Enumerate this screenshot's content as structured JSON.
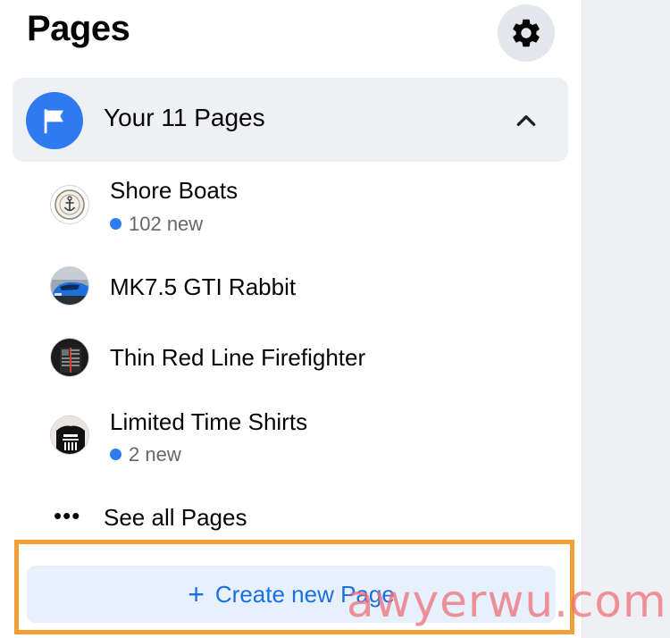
{
  "header": {
    "title": "Pages",
    "settings_icon": "gear-icon"
  },
  "pages_group": {
    "icon": "flag-icon",
    "title": "Your 11 Pages",
    "toggle_icon": "chevron-up-icon",
    "items": [
      {
        "name": "Shore Boats",
        "badge": "102 new",
        "avatar": "anchor-logo"
      },
      {
        "name": "MK7.5 GTI Rabbit",
        "badge": "",
        "avatar": "blue-car-photo"
      },
      {
        "name": "Thin Red Line Firefighter",
        "badge": "",
        "avatar": "flag-shirt-photo"
      },
      {
        "name": "Limited Time Shirts",
        "badge": "2 new",
        "avatar": "black-shirt-photo"
      }
    ],
    "see_all_label": "See all Pages",
    "see_all_icon": "more-dots-icon"
  },
  "create_button": {
    "label": "Create new Page",
    "icon": "plus-icon"
  },
  "watermark": "awyerwu.com",
  "colors": {
    "accent": "#2e7bf0",
    "highlight": "#f0a037",
    "button_bg": "#e7f0fd",
    "button_text": "#1b6fe0"
  }
}
